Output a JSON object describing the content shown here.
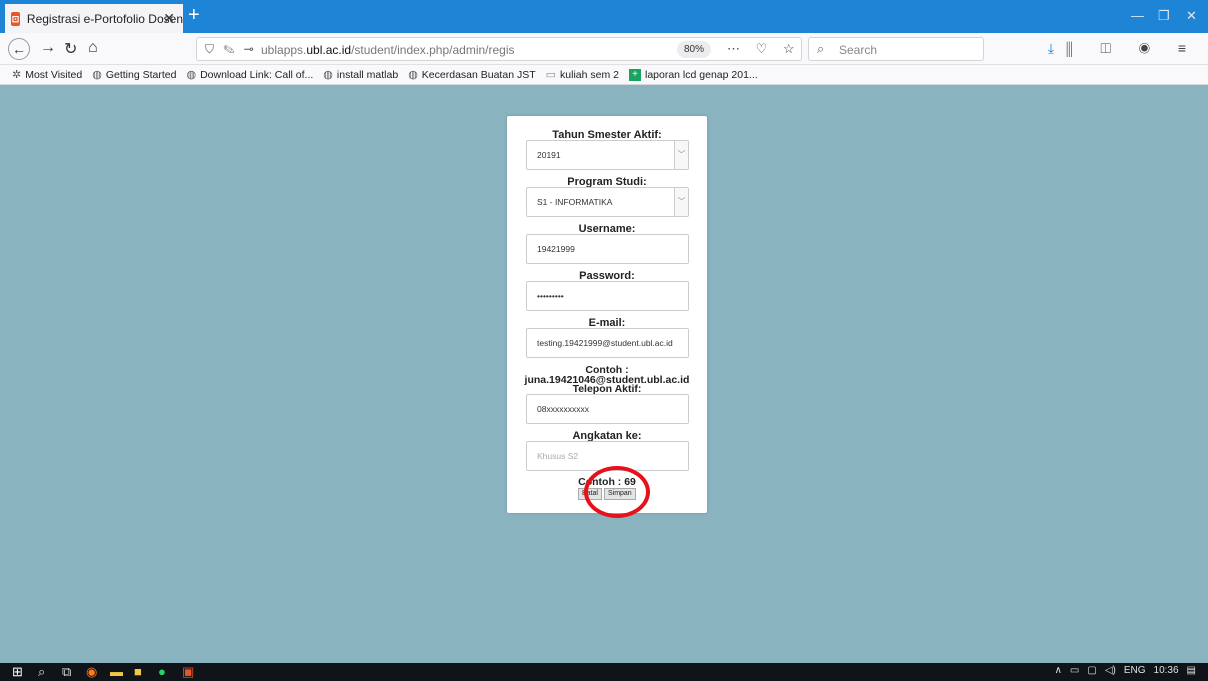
{
  "browser": {
    "tab_title": "Registrasi e-Portofolio Dosen",
    "tab_close": "✕",
    "new_tab": "+",
    "url_prefix": "ublapps.",
    "url_domain": "ubl.ac.id",
    "url_path": "/student/index.php/admin/regis",
    "zoom": "80%",
    "search_placeholder": "Search"
  },
  "bookmarks": [
    {
      "label": "Most Visited",
      "icon": "gear-icon"
    },
    {
      "label": "Getting Started",
      "icon": "globe-icon"
    },
    {
      "label": "Download Link: Call of...",
      "icon": "globe-icon"
    },
    {
      "label": "install matlab",
      "icon": "globe-icon"
    },
    {
      "label": "Kecerdasan Buatan JST",
      "icon": "globe-icon"
    },
    {
      "label": "kuliah sem 2",
      "icon": "folder-icon"
    },
    {
      "label": "laporan lcd genap 201...",
      "icon": "sheet-icon"
    }
  ],
  "form": {
    "semester_label": "Tahun Smester Aktif:",
    "semester_value": "20191",
    "prodi_label": "Program Studi:",
    "prodi_value": "S1 - INFORMATIKA",
    "username_label": "Username:",
    "username_value": "19421999",
    "password_label": "Password:",
    "password_value": "•••••••••",
    "email_label": "E-mail:",
    "email_value": "testing.19421999@student.ubl.ac.id",
    "email_hint_1": "Contoh :",
    "email_hint_2": "juna.19421046@student.ubl.ac.id",
    "phone_label": "Telepon Aktif:",
    "phone_value": "08xxxxxxxxxx",
    "angkatan_label": "Angkatan ke:",
    "angkatan_placeholder": "Khusus S2",
    "angkatan_hint": "Contoh : 69",
    "cancel_button": "Batal",
    "save_button": "Simpan"
  },
  "taskbar": {
    "lang": "ENG",
    "time": "10:36"
  },
  "colors": {
    "titlebar": "#1d84d6",
    "page_bg": "#89b3bf",
    "highlight_circle": "#e8101a"
  }
}
